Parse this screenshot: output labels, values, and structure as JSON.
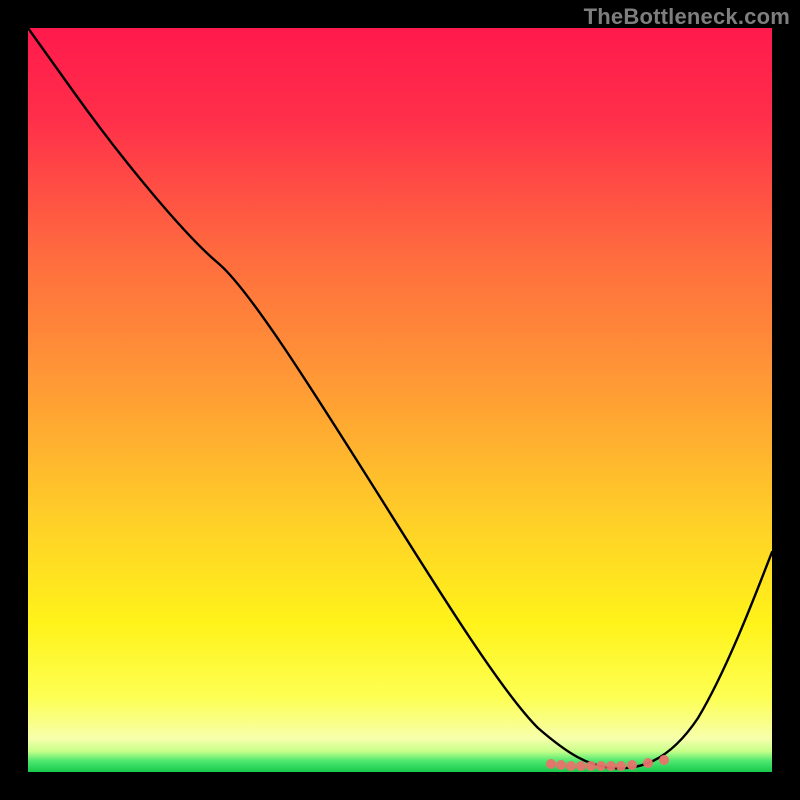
{
  "watermark": "TheBottleneck.com",
  "colors": {
    "page_bg": "#000000",
    "curve": "#000000",
    "marker": "#e9736c",
    "gradient_top": "#ff1a4c",
    "gradient_mid": "#ffcf28",
    "gradient_bottom": "#17c94d",
    "watermark_text": "#7e7e7e"
  },
  "chart_data": {
    "type": "line",
    "title": "",
    "xlabel": "",
    "ylabel": "",
    "xlim": [
      0,
      100
    ],
    "ylim": [
      0,
      100
    ],
    "grid": false,
    "legend": null,
    "notes": "Background is a vertical green→yellow→red gradient (green at y≈0, red at y=100). Curve plots bottleneck % vs an unlabeled x-axis. Values estimated from pixels; no tick labels are shown in the image.",
    "series": [
      {
        "name": "bottleneck_curve",
        "x": [
          0,
          6,
          15,
          26,
          35,
          46,
          55,
          63,
          70,
          75,
          79,
          82,
          86,
          90,
          94,
          98,
          100
        ],
        "y": [
          100,
          92,
          81,
          69,
          60,
          46,
          34,
          21,
          10,
          4,
          1,
          0.4,
          0.8,
          4,
          12,
          23,
          30
        ]
      }
    ],
    "annotations": {
      "minimum_marker_cluster_x_range": [
        70,
        86
      ],
      "minimum_marker_y": 0.5,
      "minimum_marker_count_approx": 11,
      "minimum_marker_color": "#e9736c"
    }
  }
}
